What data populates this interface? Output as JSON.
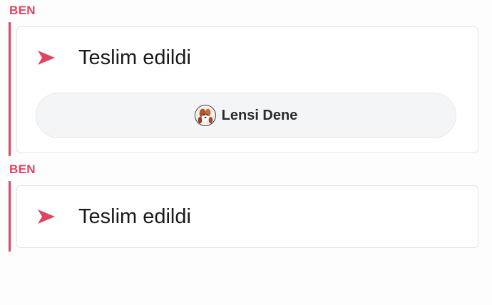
{
  "messages": [
    {
      "sender": "BEN",
      "status_icon": "arrow-icon",
      "status": "Teslim edildi",
      "viewer": {
        "avatar_icon": "avatar-icon",
        "name": "Lensi Dene"
      }
    },
    {
      "sender": "BEN",
      "status_icon": "arrow-icon",
      "status": "Teslim edildi"
    }
  ],
  "colors": {
    "accent": "#e0445f",
    "card_border": "#e4e4e6",
    "pill_background": "#f4f5f7",
    "text": "#1a1a1a"
  }
}
